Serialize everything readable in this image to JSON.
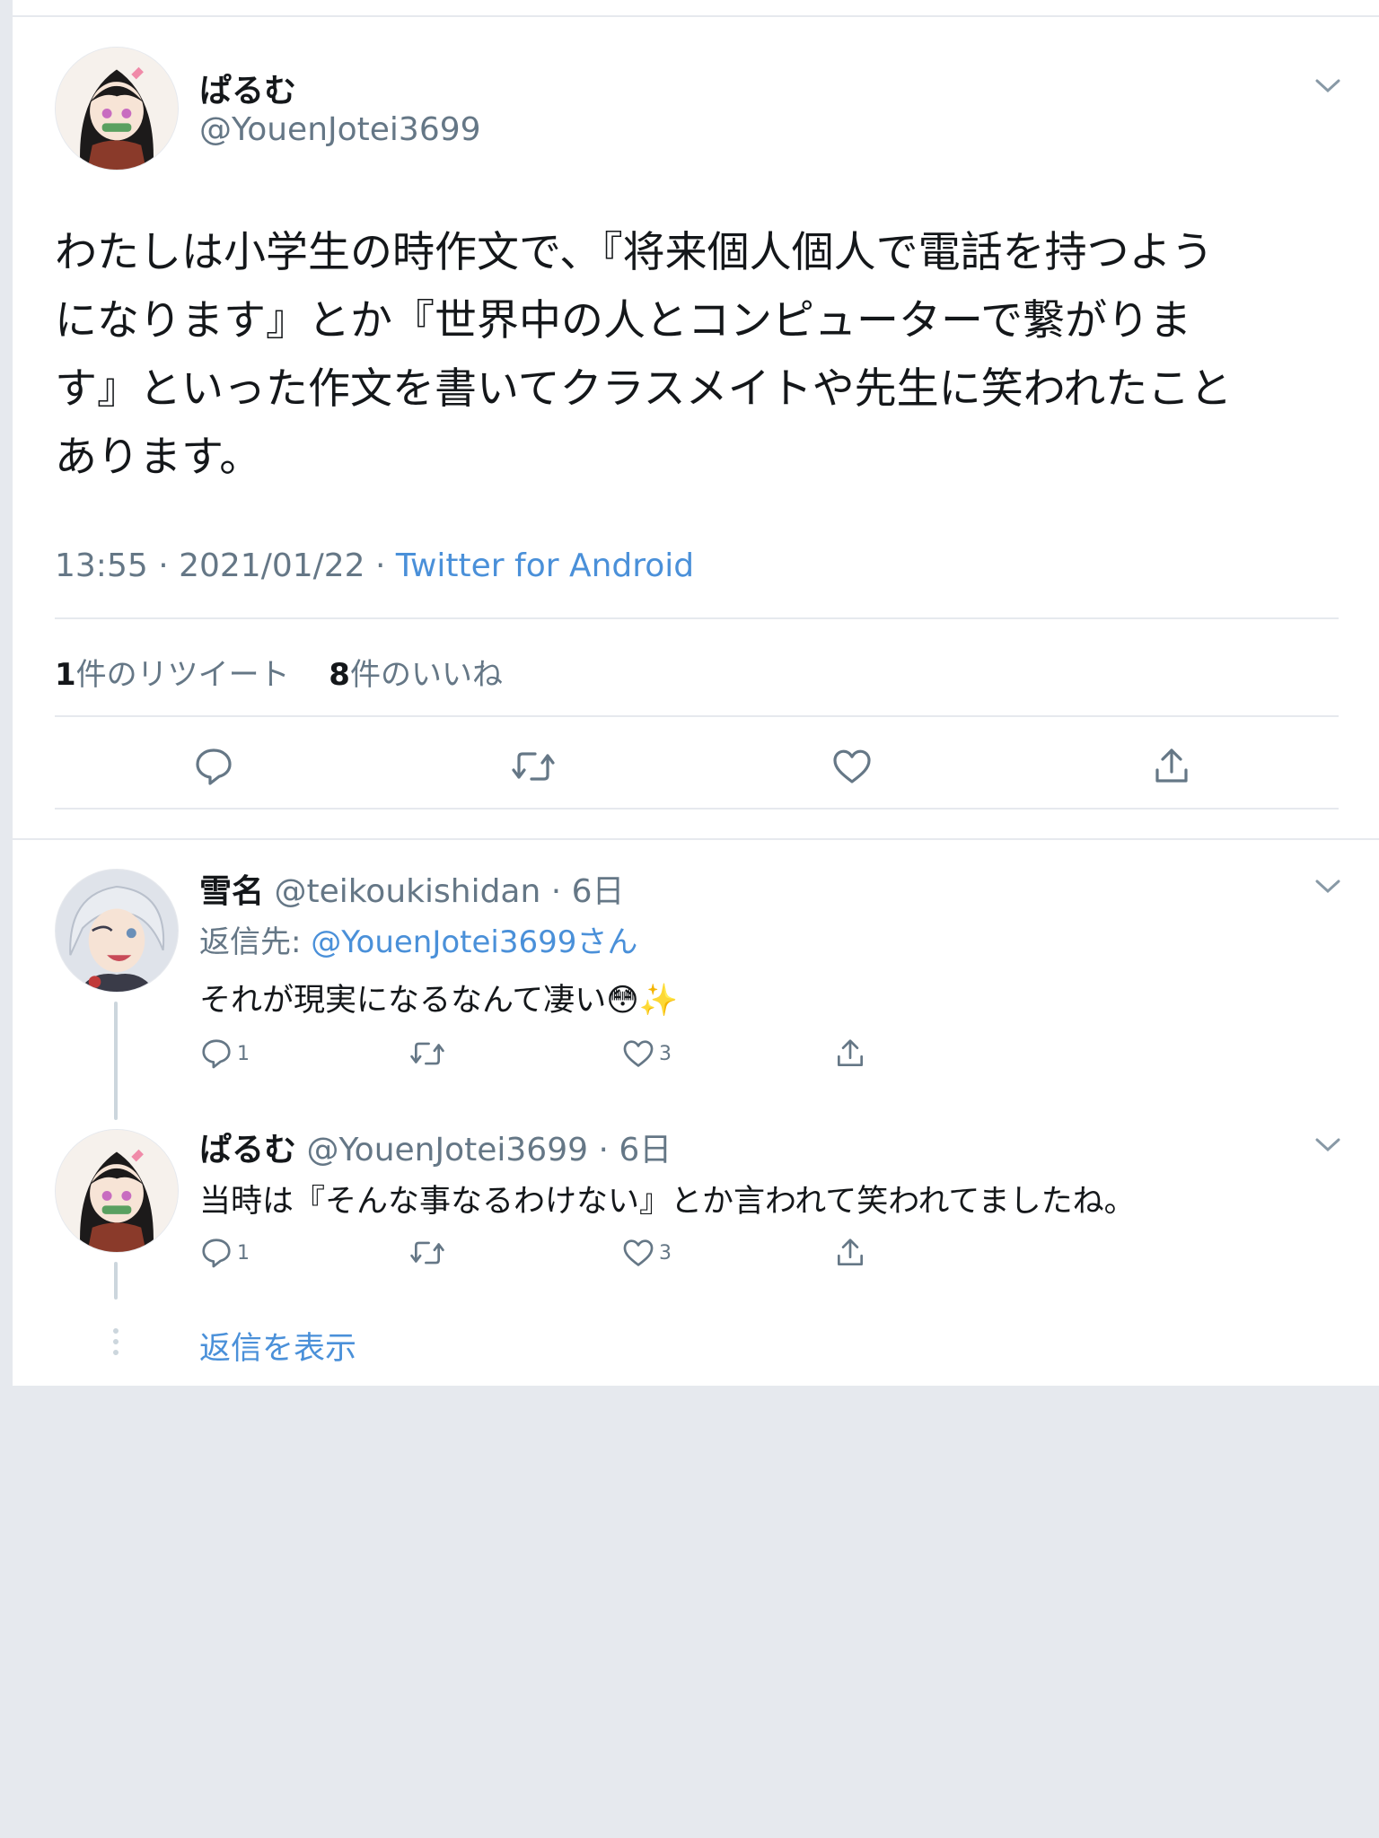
{
  "main_tweet": {
    "display_name": "ぱるむ",
    "handle": "@YouenJotei3699",
    "text_lines": [
      "わたしは小学生の時作文で、『将来個人個人で電話を持つよう",
      "になります』とか『世界中の人とコンピューターで繋がりま",
      "す』といった作文を書いてクラスメイトや先生に笑われたこと",
      "あります。"
    ],
    "time": "13:55 · 2021/01/22 ·",
    "source": "Twitter for Android",
    "retweet_count": "1",
    "retweet_label": "件のリツイート",
    "like_count": "8",
    "like_label": "件のいいね",
    "actions": [
      "reply-icon",
      "retweet-icon",
      "like-icon",
      "share-icon"
    ]
  },
  "replies": [
    {
      "display_name": "雪名",
      "handle_time": "@teikoukishidan · 6日",
      "reply_to_prefix": "返信先:",
      "reply_to_handle": "@YouenJotei3699さん",
      "text": "それが現実になるなんて凄い😳✨",
      "reply_count": "1",
      "like_count": "3"
    },
    {
      "display_name": "ぱるむ",
      "handle_time": "@YouenJotei3699 · 6日",
      "text": "当時は『そんな事なるわけない』とか言われて笑われてましたね。",
      "reply_count": "1",
      "like_count": "3"
    }
  ],
  "show_replies_label": "返信を表示",
  "colors": {
    "accent": "#4a90d9",
    "muted": "#657786",
    "divider": "#e6e9ee",
    "background": "#e6e9ee"
  }
}
